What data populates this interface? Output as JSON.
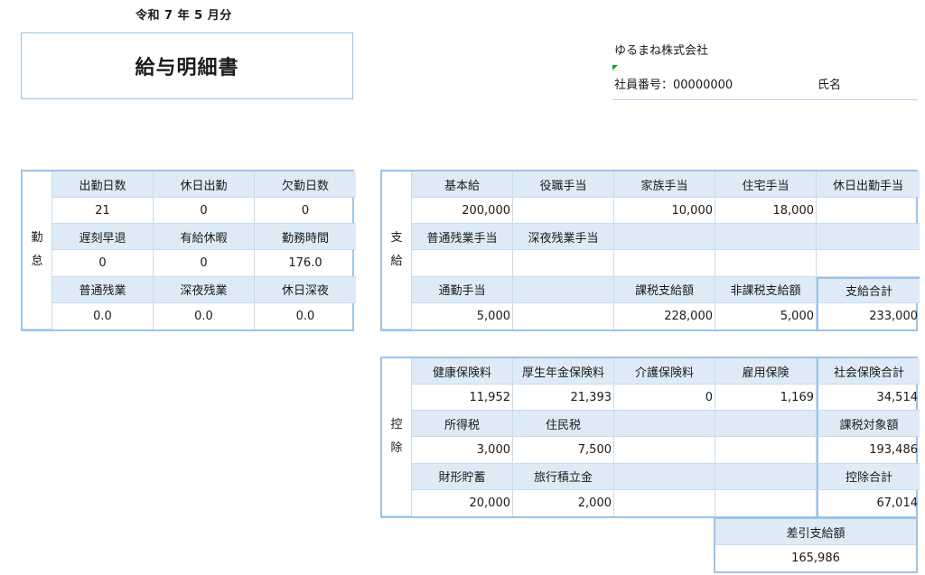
{
  "header": {
    "period": "令和 7 年 5 月分",
    "title": "給与明細書",
    "company": "ゆるまね株式会社",
    "employee_label": "社員番号：00000000",
    "name_label": "氏名"
  },
  "attendance": {
    "side_label": [
      "勤",
      "怠"
    ],
    "rows": [
      {
        "headers": [
          "出勤日数",
          "休日出勤",
          "欠勤日数"
        ],
        "values": [
          "21",
          "0",
          "0"
        ]
      },
      {
        "headers": [
          "遅刻早退",
          "有給休暇",
          "勤務時間"
        ],
        "values": [
          "0",
          "0",
          "176.0"
        ]
      },
      {
        "headers": [
          "普通残業",
          "深夜残業",
          "休日深夜"
        ],
        "values": [
          "0.0",
          "0.0",
          "0.0"
        ]
      }
    ]
  },
  "pay": {
    "side_label": [
      "支",
      "給"
    ],
    "rows": [
      {
        "headers": [
          "基本給",
          "役職手当",
          "家族手当",
          "住宅手当",
          "休日出勤手当"
        ],
        "values": [
          "200,000",
          "",
          "10,000",
          "18,000",
          ""
        ]
      },
      {
        "headers": [
          "普通残業手当",
          "深夜残業手当",
          "",
          "",
          ""
        ],
        "values": [
          "",
          "",
          "",
          "",
          ""
        ]
      },
      {
        "headers": [
          "通勤手当",
          "",
          "課税支給額",
          "非課税支給額",
          "支給合計"
        ],
        "values": [
          "5,000",
          "",
          "228,000",
          "5,000",
          "233,000"
        ]
      }
    ]
  },
  "deductions": {
    "side_label": [
      "控",
      "除"
    ],
    "rows": [
      {
        "headers": [
          "健康保険料",
          "厚生年金保険料",
          "介護保険料",
          "雇用保険",
          "社会保険合計"
        ],
        "values": [
          "11,952",
          "21,393",
          "0",
          "1,169",
          "34,514"
        ]
      },
      {
        "headers": [
          "所得税",
          "住民税",
          "",
          "",
          "課税対象額"
        ],
        "values": [
          "3,000",
          "7,500",
          "",
          "",
          "193,486"
        ]
      },
      {
        "headers": [
          "財形貯蓄",
          "旅行積立金",
          "",
          "",
          "控除合計"
        ],
        "values": [
          "20,000",
          "2,000",
          "",
          "",
          "67,014"
        ]
      }
    ]
  },
  "net_pay": {
    "label": "差引支給額",
    "value": "165,986"
  }
}
